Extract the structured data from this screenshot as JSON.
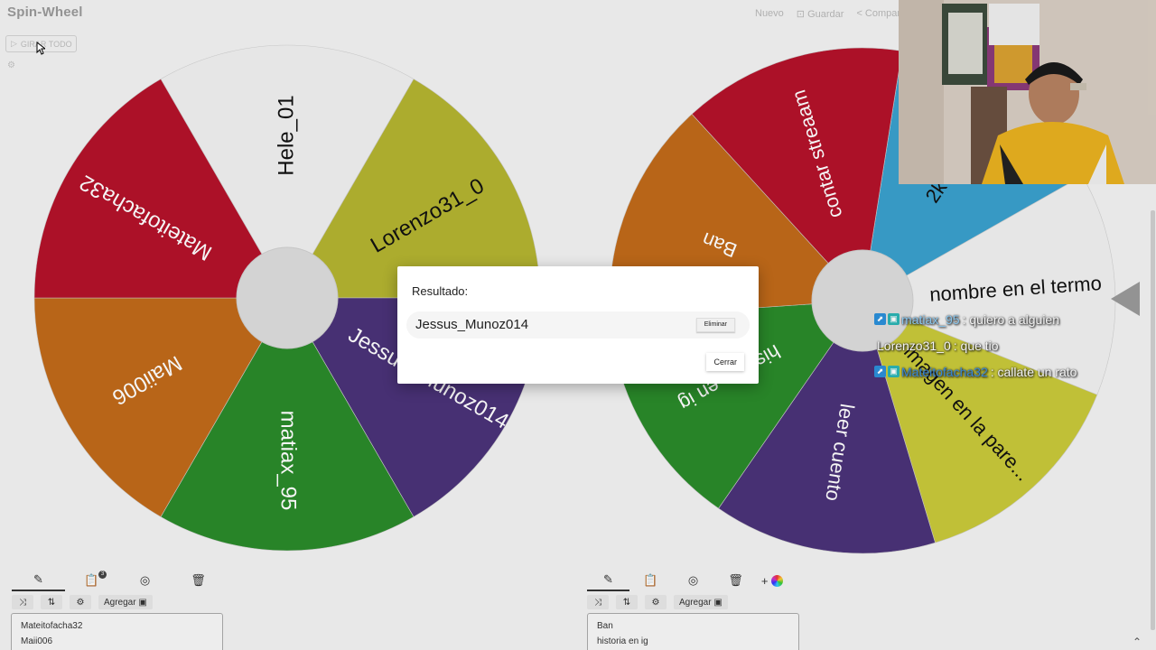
{
  "app": {
    "logo": "Spin-Wheel",
    "nav": [
      {
        "label": "Nuevo"
      },
      {
        "label": "⊡ Guardar"
      },
      {
        "label": "< Compar"
      }
    ],
    "spin_all_label": "GIRAR TODO"
  },
  "wheel_left": {
    "entries": [
      {
        "label": "Hele_01",
        "color": "#f0f0f0"
      },
      {
        "label": "Lorenzo31_0",
        "color": "#b3b330"
      },
      {
        "label": "Jessus_Munoz014",
        "color": "#4a3278"
      },
      {
        "label": "matiax_95",
        "color": "#2a8a2a"
      },
      {
        "label": "Maii006",
        "color": "#c06a1a"
      },
      {
        "label": "Mateitofacha32",
        "color": "#b3122a"
      }
    ]
  },
  "wheel_right": {
    "entries": [
      {
        "label": "2k de p",
        "color": "#3aa0cc"
      },
      {
        "label": "nombre en el termo",
        "color": "#f0f0f0"
      },
      {
        "label": "imagen en la pare...",
        "color": "#c8c83a"
      },
      {
        "label": "leer cuento",
        "color": "#4a3278"
      },
      {
        "label": "historia en ig",
        "color": "#2a8a2a"
      },
      {
        "label": "Ban",
        "color": "#c06a1a"
      },
      {
        "label": "contar streaam",
        "color": "#b3122a"
      }
    ]
  },
  "toolbar_left": {
    "add_label": "Agregar",
    "badge": "3",
    "entries_preview": [
      "Mateitofacha32",
      "Maii006"
    ]
  },
  "toolbar_right": {
    "add_label": "Agregar",
    "plus": "+",
    "entries_preview": [
      "Ban",
      "historia en ig"
    ]
  },
  "dialog": {
    "title": "Resultado:",
    "result": "Jessus_Munoz014",
    "remove_label": "Eliminar",
    "close_label": "Cerrar"
  },
  "chat": [
    {
      "user": "matiax_95",
      "message": ": quiero a alguien",
      "badges": true
    },
    {
      "user": "Lorenzo31_0",
      "message": ": que tio",
      "badges": false
    },
    {
      "user": "Mateitofacha32",
      "message": ": callate un rato",
      "badges": true
    }
  ],
  "colors": {
    "pointer": "#9a9a9a",
    "center": "#dcdcdc"
  }
}
